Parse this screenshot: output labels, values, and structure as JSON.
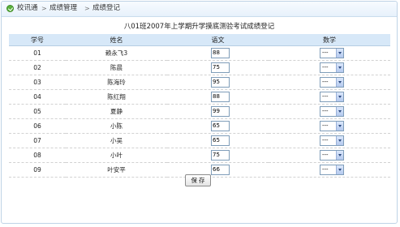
{
  "breadcrumb": {
    "items": [
      "校讯通",
      "成绩管理",
      "成绩登记"
    ],
    "separator": ">"
  },
  "page_title": "八01班2007年上学期升学摸底测验考试成绩登记",
  "table": {
    "headers": {
      "id": "学号",
      "name": "姓名",
      "chinese": "语文",
      "math": "数学"
    },
    "rows": [
      {
        "id": "01",
        "name": "赖永飞3",
        "chinese": "88",
        "math": "---"
      },
      {
        "id": "02",
        "name": "陈晨",
        "chinese": "75",
        "math": "---"
      },
      {
        "id": "03",
        "name": "陈海玲",
        "chinese": "95",
        "math": "---"
      },
      {
        "id": "04",
        "name": "陈红翔",
        "chinese": "88",
        "math": "---"
      },
      {
        "id": "05",
        "name": "夏静",
        "chinese": "99",
        "math": "---"
      },
      {
        "id": "06",
        "name": "小陈",
        "chinese": "65",
        "math": "---"
      },
      {
        "id": "07",
        "name": "小吴",
        "chinese": "65",
        "math": "---"
      },
      {
        "id": "08",
        "name": "小叶",
        "chinese": "75",
        "math": "---"
      },
      {
        "id": "09",
        "name": "叶安平",
        "chinese": "66",
        "math": "---"
      }
    ]
  },
  "save_label": "保 存",
  "colors": {
    "header_bg": "#d7e8f8",
    "border": "#bfd3e6",
    "icon_green": "#5bb23d"
  }
}
